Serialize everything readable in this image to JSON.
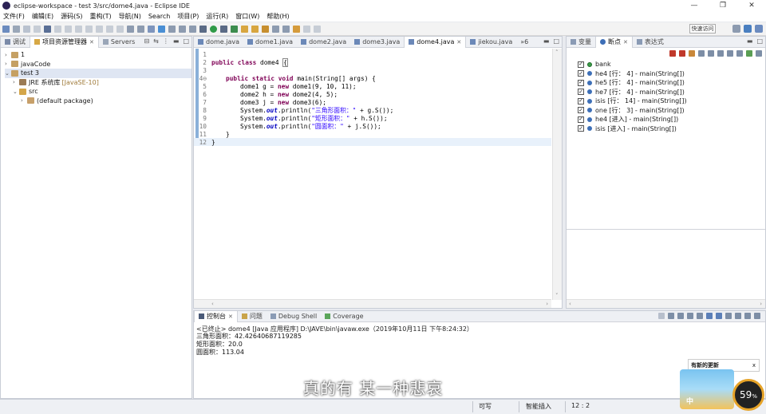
{
  "window": {
    "title": "eclipse-workspace - test 3/src/dome4.java - Eclipse IDE",
    "controls": [
      "—",
      "❐",
      "✕"
    ]
  },
  "menu": [
    "文件(F)",
    "编辑(E)",
    "源码(S)",
    "重构(T)",
    "导航(N)",
    "Search",
    "项目(P)",
    "运行(R)",
    "窗口(W)",
    "帮助(H)"
  ],
  "toolbar": {
    "quick_access": "快速访问"
  },
  "explorer": {
    "tabs": [
      {
        "label": "调试",
        "active": false
      },
      {
        "label": "项目资源管理器",
        "active": true
      },
      {
        "label": "Servers",
        "active": false
      }
    ],
    "tree": [
      {
        "indent": 0,
        "arrow": "›",
        "label": "1",
        "suffix": ""
      },
      {
        "indent": 0,
        "arrow": "›",
        "label": "javaCode",
        "suffix": ""
      },
      {
        "indent": 0,
        "arrow": "⌄",
        "label": "test 3",
        "suffix": "",
        "selected": true
      },
      {
        "indent": 1,
        "arrow": "›",
        "label": "JRE 系统库",
        "suffix": "[JavaSE-10]"
      },
      {
        "indent": 1,
        "arrow": "⌄",
        "label": "src",
        "suffix": ""
      },
      {
        "indent": 2,
        "arrow": "›",
        "label": "(default package)",
        "suffix": ""
      }
    ]
  },
  "editor": {
    "tabs": [
      {
        "label": "dome.java",
        "active": false
      },
      {
        "label": "dome1.java",
        "active": false
      },
      {
        "label": "dome2.java",
        "active": false
      },
      {
        "label": "dome3.java",
        "active": false
      },
      {
        "label": "dome4.java",
        "active": true
      },
      {
        "label": "jiekou.java",
        "active": false
      }
    ],
    "overflow": "»6",
    "line_numbers": [
      "1",
      "2",
      "3",
      "4⊖",
      "5",
      "6",
      "7",
      "8",
      "9",
      "10",
      "11",
      "12"
    ],
    "code": {
      "l2_kw": "public class",
      "l2_name": " dome4 ",
      "l2_brace": "{",
      "l4_kw": "public static void",
      "l4_rest": " main(String[] args) {",
      "l5_a": "dome1 g = ",
      "l5_kw": "new",
      "l5_b": " dome1(9, 10, 11);",
      "l6_a": "dome2 h = ",
      "l6_kw": "new",
      "l6_b": " dome2(4, 5);",
      "l7_a": "dome3 j = ",
      "l7_kw": "new",
      "l7_b": " dome3(6);",
      "l8_a": "System.",
      "l8_out": "out",
      "l8_b": ".println(",
      "l8_str": "\"三角形面积：\"",
      "l8_c": " + g.S());",
      "l9_a": "System.",
      "l9_out": "out",
      "l9_b": ".println(",
      "l9_str": "\"矩形面积：\"",
      "l9_c": " + h.S());",
      "l10_a": "System.",
      "l10_out": "out",
      "l10_b": ".println(",
      "l10_str": "\"圆面积：\"",
      "l10_c": " + j.S());",
      "l11": "}",
      "l12": "}"
    }
  },
  "breakpoints": {
    "tabs": [
      {
        "label": "变量",
        "active": false
      },
      {
        "label": "断点",
        "active": true
      },
      {
        "label": "表达式",
        "active": false
      }
    ],
    "items": [
      {
        "label": "bank",
        "type": "class"
      },
      {
        "label": "he4 [行： 4] - main(String[])",
        "type": "line"
      },
      {
        "label": "he5 [行： 4] - main(String[])",
        "type": "line"
      },
      {
        "label": "he7 [行： 4] - main(String[])",
        "type": "line"
      },
      {
        "label": "isis [行： 14] - main(String[])",
        "type": "line"
      },
      {
        "label": "one [行： 3] - main(String[])",
        "type": "line"
      },
      {
        "label": "he4 [进入] - main(String[])",
        "type": "entry"
      },
      {
        "label": "isis [进入] - main(String[])",
        "type": "entry"
      }
    ]
  },
  "console": {
    "tabs": [
      {
        "label": "控制台",
        "active": true
      },
      {
        "label": "问题",
        "active": false
      },
      {
        "label": "Debug Shell",
        "active": false
      },
      {
        "label": "Coverage",
        "active": false
      }
    ],
    "header": "<已终止> dome4 [Java 应用程序] D:\\JAVE\\bin\\javaw.exe（2019年10月11日 下午8:24:32）",
    "output": [
      "三角形面积：42.42640687119285",
      "矩形面积：20.0",
      "圆面积：113.04"
    ]
  },
  "status": {
    "writable": "可写",
    "insert_mode": "智能插入",
    "position": "12 : 2"
  },
  "overlay": {
    "subtitle": "真的有 某一种悲哀",
    "popup_title": "有新的更新",
    "popup_close": "x",
    "ad_badge": "中",
    "speed_value": "59",
    "speed_unit": "%"
  }
}
